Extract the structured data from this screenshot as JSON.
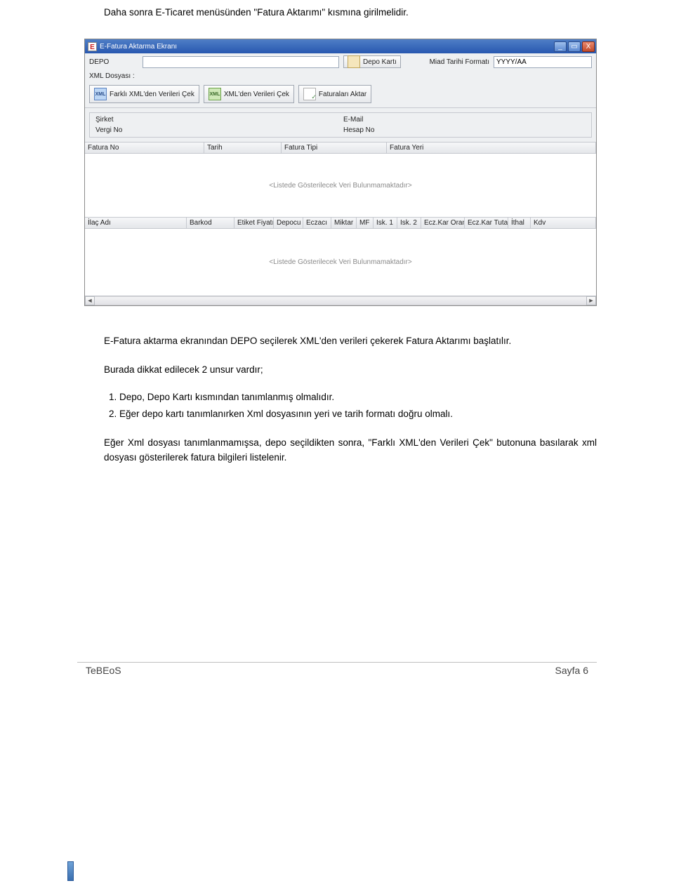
{
  "doc": {
    "intro": "Daha sonra E-Ticaret menüsünden \"Fatura Aktarımı\" kısmına girilmelidir.",
    "p1": "E-Fatura aktarma ekranından DEPO seçilerek XML'den verileri çekerek Fatura Aktarımı başlatılır.",
    "p2": "Burada dikkat edilecek 2 unsur vardır;",
    "li1": "Depo, Depo Kartı kısmından tanımlanmış olmalıdır.",
    "li2": "Eğer depo kartı tanımlanırken Xml dosyasının yeri ve tarih formatı doğru olmalı.",
    "p3": "Eğer Xml dosyası tanımlanmamışsa, depo seçildikten sonra, \"Farklı XML'den Verileri Çek\" butonuna basılarak xml dosyası gösterilerek fatura bilgileri listelenir."
  },
  "app": {
    "icon_letter": "E",
    "title": "E-Fatura Aktarma Ekranı",
    "min_glyph": "_",
    "max_glyph": "▭",
    "close_glyph": "X",
    "line1": {
      "depo_label": "DEPO",
      "depo_value": "",
      "depo_karti_btn": "Depo Kartı",
      "miad_label": "Miad Tarihi Formatı",
      "miad_value": "YYYY/AA"
    },
    "line2": {
      "xml_label": "XML Dosyası :",
      "xml_value": ""
    },
    "toolbar": {
      "b1": "Farklı XML'den Verileri Çek",
      "b2": "XML'den Verileri Çek",
      "b3": "Faturaları Aktar"
    },
    "info": {
      "sirket_l": "Şirket",
      "sirket_v": "",
      "email_l": "E-Mail",
      "email_v": "",
      "vergi_l": "Vergi No",
      "vergi_v": "",
      "hesap_l": "Hesap No",
      "hesap_v": ""
    },
    "grid1_cols": [
      "Fatura No",
      "Tarih",
      "Fatura Tipi",
      "Fatura Yeri"
    ],
    "grid1_empty": "<Listede Gösterilecek Veri Bulunmamaktadır>",
    "grid2_cols": [
      "İlaç Adı",
      "Barkod",
      "Etiket Fiyatı",
      "Depocu",
      "Eczacı",
      "Miktar",
      "MF",
      "Isk. 1",
      "Isk. 2",
      "Ecz.Kar Oranı",
      "Ecz.Kar Tutarı",
      "İthal",
      "Kdv"
    ],
    "grid2_empty": "<Listede Gösterilecek Veri Bulunmamaktadır>",
    "sb_left": "◄",
    "sb_right": "►"
  },
  "footer": {
    "left": "TeBEoS",
    "right": "Sayfa 6"
  }
}
